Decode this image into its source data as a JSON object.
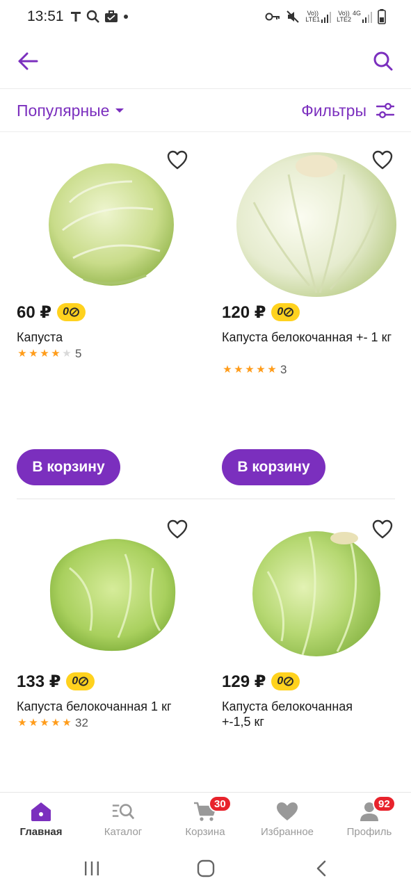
{
  "status_bar": {
    "time": "13:51",
    "left_icons": [
      "t-app-icon",
      "search-icon",
      "briefcase-icon",
      "dot-icon"
    ],
    "right_icons": [
      "key-icon",
      "mute-icon",
      "lte1-signal-icon",
      "lte2-signal-icon",
      "battery-icon"
    ],
    "sim1_label_top": "Vo))",
    "sim1_label_bottom": "LTE1",
    "sim2_label_top": "Vo))",
    "sim2_label_bottom": "LTE2",
    "network_type": "4G"
  },
  "app_bar": {
    "back_icon": "arrow-left-icon",
    "search_icon": "search-icon"
  },
  "sort_bar": {
    "sort_label": "Популярные",
    "filter_label": "Фильтры"
  },
  "products": [
    {
      "price": "60 ₽",
      "bonus": "0",
      "name": "Капуста",
      "rating": 4,
      "reviews": "5",
      "cart_label": "В корзину"
    },
    {
      "price": "120 ₽",
      "bonus": "0",
      "name": "Капуста белокочанная +- 1 кг",
      "rating": 5,
      "reviews": "3",
      "cart_label": "В корзину"
    },
    {
      "price": "133 ₽",
      "bonus": "0",
      "name": "Капуста белокочанная 1 кг",
      "rating": 5,
      "reviews": "32"
    },
    {
      "price": "129 ₽",
      "bonus": "0",
      "name": "Капуста белокочанная +-1,5 кг"
    }
  ],
  "bottom_nav": {
    "items": [
      {
        "label": "Главная",
        "icon": "home-icon",
        "active": true
      },
      {
        "label": "Каталог",
        "icon": "catalog-search-icon"
      },
      {
        "label": "Корзина",
        "icon": "cart-icon",
        "badge": "30"
      },
      {
        "label": "Избранное",
        "icon": "heart-icon"
      },
      {
        "label": "Профиль",
        "icon": "profile-icon",
        "badge": "92"
      }
    ]
  },
  "colors": {
    "accent": "#7b2fbe",
    "badge_red": "#e8232c",
    "bonus_yellow": "#ffd21e",
    "star_orange": "#ff9c1a"
  }
}
